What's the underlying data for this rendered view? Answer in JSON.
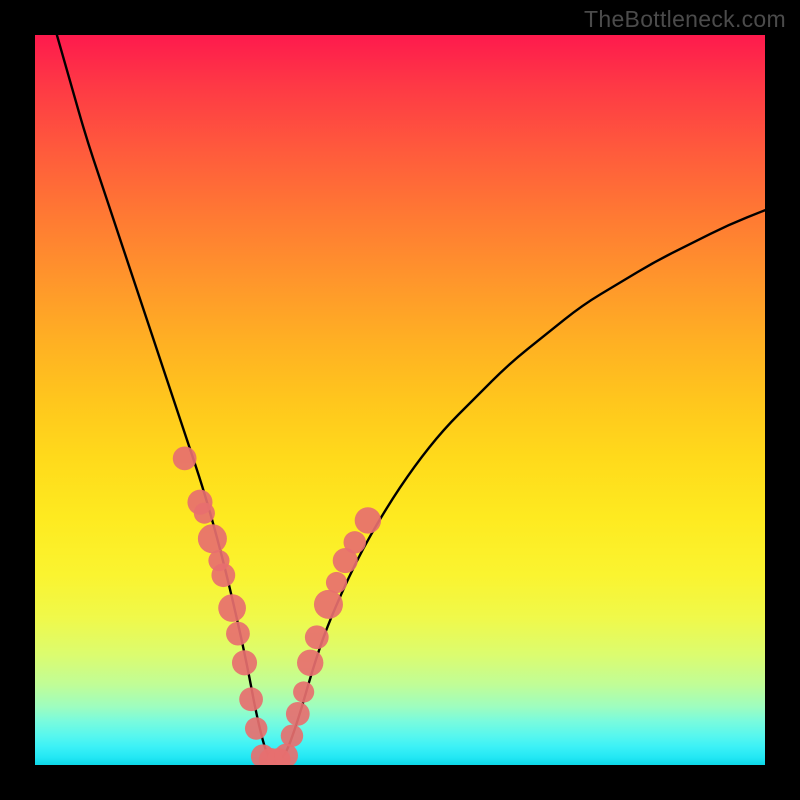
{
  "watermark": "TheBottleneck.com",
  "chart_data": {
    "type": "line",
    "title": "",
    "xlabel": "",
    "ylabel": "",
    "xlim": [
      0,
      100
    ],
    "ylim": [
      0,
      100
    ],
    "grid": false,
    "legend": false,
    "curve": {
      "name": "bottleneck-curve",
      "x": [
        3,
        5,
        7,
        9,
        11,
        13,
        15,
        17,
        19,
        21,
        23,
        25,
        27,
        29,
        30.5,
        32,
        34,
        36,
        38,
        40,
        44,
        48,
        52,
        56,
        60,
        65,
        70,
        75,
        80,
        85,
        90,
        95,
        100
      ],
      "y": [
        100,
        93,
        86,
        80,
        74,
        68,
        62,
        56,
        50,
        44,
        38,
        31,
        23,
        14,
        6,
        0.5,
        0.5,
        6,
        13,
        19,
        28,
        35,
        41,
        46,
        50,
        55,
        59,
        63,
        66,
        69,
        71.5,
        74,
        76
      ]
    },
    "dots_left": {
      "name": "left-data-points",
      "color": "#e76f6f",
      "points": [
        {
          "x": 20.5,
          "y": 42,
          "r": 1.2
        },
        {
          "x": 22.6,
          "y": 36,
          "r": 1.3
        },
        {
          "x": 23.2,
          "y": 34.5,
          "r": 1.0
        },
        {
          "x": 24.3,
          "y": 31,
          "r": 1.6
        },
        {
          "x": 25.2,
          "y": 28,
          "r": 1.0
        },
        {
          "x": 25.8,
          "y": 26,
          "r": 1.2
        },
        {
          "x": 27.0,
          "y": 21.5,
          "r": 1.5
        },
        {
          "x": 27.8,
          "y": 18,
          "r": 1.2
        },
        {
          "x": 28.7,
          "y": 14,
          "r": 1.3
        },
        {
          "x": 29.6,
          "y": 9,
          "r": 1.2
        },
        {
          "x": 30.3,
          "y": 5,
          "r": 1.1
        }
      ]
    },
    "dots_right": {
      "name": "right-data-points",
      "color": "#e76f6f",
      "points": [
        {
          "x": 35.2,
          "y": 4,
          "r": 1.1
        },
        {
          "x": 36.0,
          "y": 7,
          "r": 1.2
        },
        {
          "x": 36.8,
          "y": 10,
          "r": 1.0
        },
        {
          "x": 37.7,
          "y": 14,
          "r": 1.4
        },
        {
          "x": 38.6,
          "y": 17.5,
          "r": 1.2
        },
        {
          "x": 40.2,
          "y": 22,
          "r": 1.6
        },
        {
          "x": 41.3,
          "y": 25,
          "r": 1.0
        },
        {
          "x": 42.5,
          "y": 28,
          "r": 1.3
        },
        {
          "x": 43.8,
          "y": 30.5,
          "r": 1.1
        },
        {
          "x": 45.6,
          "y": 33.5,
          "r": 1.4
        }
      ]
    },
    "dots_bottom": {
      "name": "bottom-data-points",
      "color": "#e76f6f",
      "points": [
        {
          "x": 31.2,
          "y": 1.2,
          "r": 1.2
        },
        {
          "x": 32.3,
          "y": 0.7,
          "r": 1.2
        },
        {
          "x": 33.4,
          "y": 0.7,
          "r": 1.2
        },
        {
          "x": 34.4,
          "y": 1.3,
          "r": 1.2
        }
      ]
    },
    "gradient_stops": [
      {
        "pos": 0,
        "color": "#fe1a4d"
      },
      {
        "pos": 50,
        "color": "#ffc61d"
      },
      {
        "pos": 80,
        "color": "#eff94b"
      },
      {
        "pos": 100,
        "color": "#0dd7e7"
      }
    ]
  }
}
